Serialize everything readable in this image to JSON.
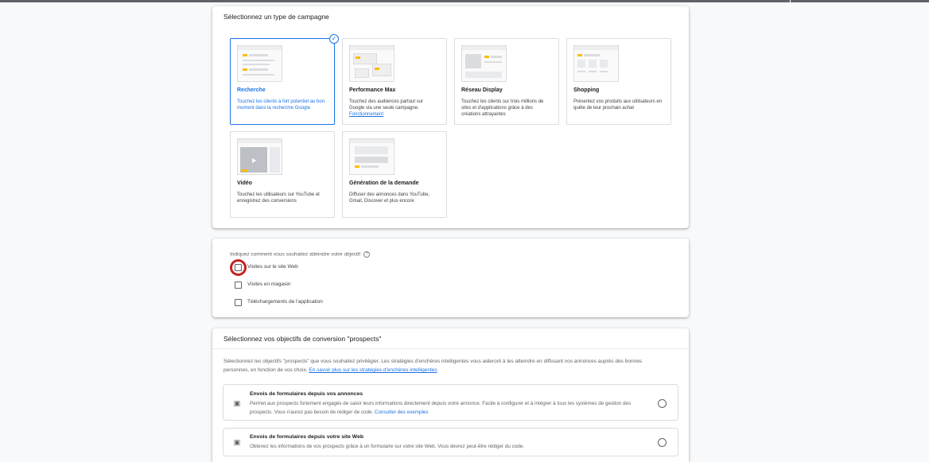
{
  "campaign_type": {
    "title": "Sélectionnez un type de campagne",
    "tiles": [
      {
        "name": "Recherche",
        "desc": "Touchez les clients à fort potentiel au bon moment dans la recherche Google",
        "selected": true
      },
      {
        "name": "Performance Max",
        "desc": "Touchez des audiences partout sur Google via une seule campagne.",
        "link": "Fonctionnement"
      },
      {
        "name": "Réseau Display",
        "desc": "Touchez les clients sur trois millions de sites et d'applications grâce à des créations attrayantes"
      },
      {
        "name": "Shopping",
        "desc": "Présentez vos produits aux utilisateurs en quête de leur prochain achat"
      },
      {
        "name": "Vidéo",
        "desc": "Touchez les utilisateurs sur YouTube et enregistrez des conversions"
      },
      {
        "name": "Génération de la demande",
        "desc": "Diffuser des annonces dans YouTube, Gmail, Discover et plus encore"
      }
    ],
    "selected_icon": "check-icon"
  },
  "goal": {
    "question": "Indiquez comment vous souhaitez atteindre votre objectif",
    "help_icon": "help-icon",
    "options": [
      {
        "label": "Visites sur le site Web",
        "checked": false
      },
      {
        "label": "Visites en magasin",
        "checked": false
      },
      {
        "label": "Téléchargements de l'application",
        "checked": false
      }
    ]
  },
  "conversion": {
    "title": "Sélectionnez vos objectifs de conversion \"prospects\"",
    "intro": "Sélectionnez les objectifs \"prospects\" que vous souhaitez privilégier. Les stratégies d'enchères intelligentes vous aideront à les atteindre en diffusant vos annonces auprès des bonnes personnes, en fonction de vos choix.",
    "intro_link": "En savoir plus sur les stratégies d'enchères intelligentes",
    "options": [
      {
        "title": "Envois de formulaires depuis vos annonces",
        "desc": "Permet aux prospects fortement engagés de saisir leurs informations directement depuis votre annonce. Facile à configurer et à intégrer à tous les systèmes de gestion des prospects. Vous n'aurez pas besoin de rédiger de code.",
        "link": "Consulter des exemples",
        "icon": "form-contact-icon"
      },
      {
        "title": "Envois de formulaires depuis votre site Web",
        "desc": "Obtenez les informations de vos prospects grâce à un formulaire sur votre site Web. Vous devrez peut-être rédiger du code.",
        "icon": "form-contact-icon"
      }
    ]
  },
  "colors": {
    "accent": "#1a73e8",
    "highlight": "#c5221f",
    "thumb_accent": "#fbbc04"
  }
}
